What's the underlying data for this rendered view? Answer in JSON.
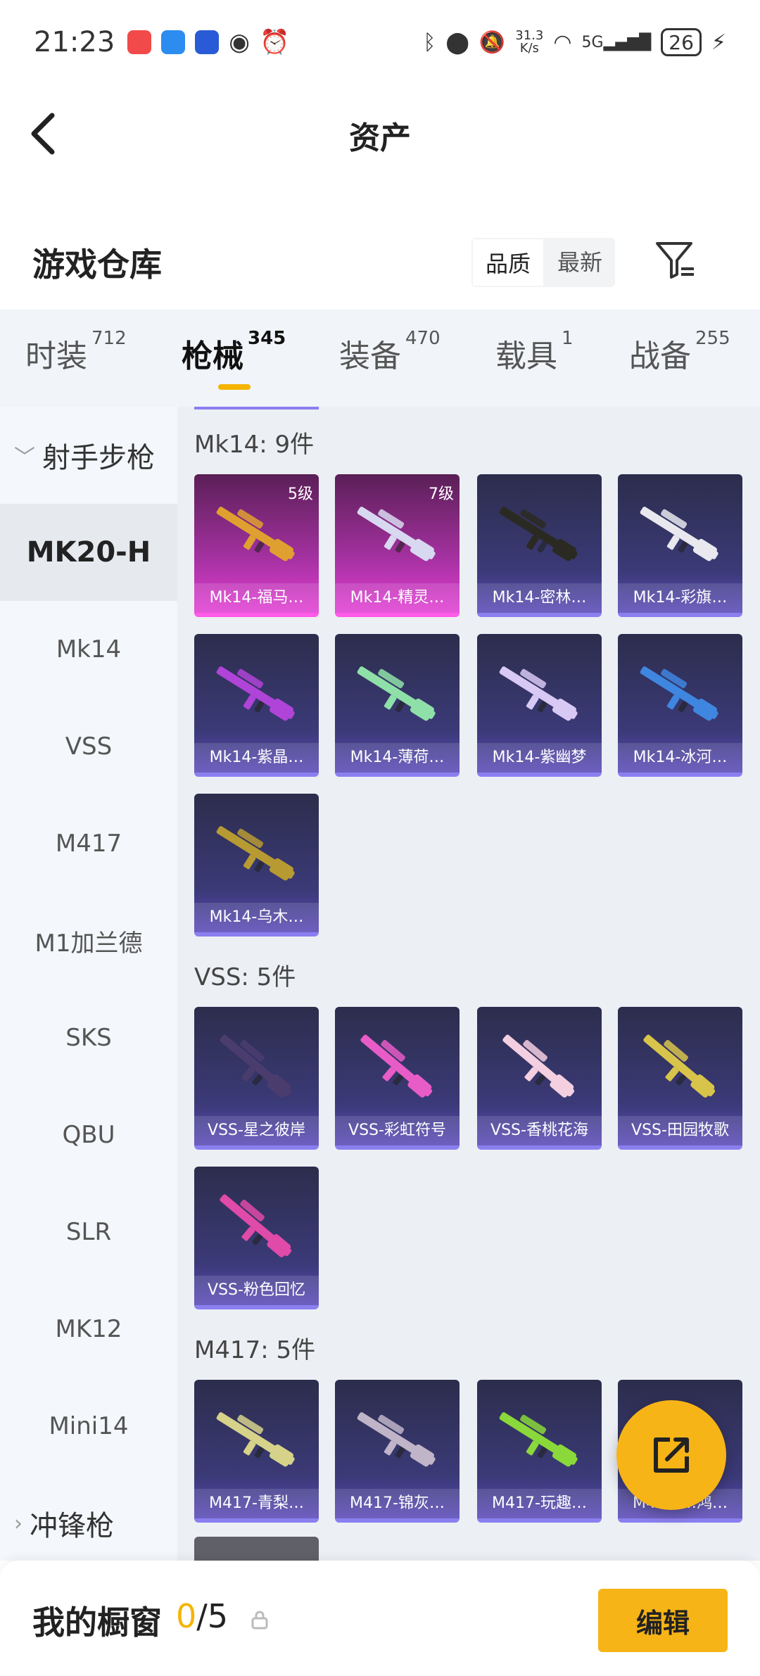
{
  "status_bar": {
    "time": "21:23",
    "speed_top": "31.3",
    "speed_bottom": "K/s",
    "battery": "26",
    "network": "5G"
  },
  "header": {
    "title": "资产"
  },
  "warehouse": {
    "title": "游戏仓库",
    "sort_quality": "品质",
    "sort_latest": "最新"
  },
  "tabs": [
    {
      "label": "时装",
      "count": "712"
    },
    {
      "label": "枪械",
      "count": "345"
    },
    {
      "label": "装备",
      "count": "470"
    },
    {
      "label": "载具",
      "count": "1"
    },
    {
      "label": "战备",
      "count": "255"
    }
  ],
  "sidebar": {
    "group1": "射手步枪",
    "items": [
      "MK20-H",
      "Mk14",
      "VSS",
      "M417",
      "M1加兰德",
      "SKS",
      "QBU",
      "SLR",
      "MK12",
      "Mini14"
    ],
    "group2": "冲锋枪"
  },
  "sections": [
    {
      "title": "Mk14: 9件",
      "cards": [
        {
          "name": "Mk14-福马…",
          "level": "5级",
          "style": "pink",
          "color": "#e0a030"
        },
        {
          "name": "Mk14-精灵…",
          "level": "7级",
          "style": "pink",
          "color": "#d8d8f0"
        },
        {
          "name": "Mk14-密林…",
          "level": "",
          "style": "normal",
          "color": "#2b2a22"
        },
        {
          "name": "Mk14-彩旗…",
          "level": "",
          "style": "normal",
          "color": "#e8e8ee"
        },
        {
          "name": "Mk14-紫晶…",
          "level": "",
          "style": "normal",
          "color": "#b044d8"
        },
        {
          "name": "Mk14-薄荷…",
          "level": "",
          "style": "normal",
          "color": "#8fe0a8"
        },
        {
          "name": "Mk14-紫幽梦",
          "level": "",
          "style": "normal",
          "color": "#d8c8f4"
        },
        {
          "name": "Mk14-冰河…",
          "level": "",
          "style": "normal",
          "color": "#3f86e0"
        },
        {
          "name": "Mk14-乌木…",
          "level": "",
          "style": "normal",
          "color": "#b89a32"
        }
      ]
    },
    {
      "title": "VSS: 5件",
      "cards": [
        {
          "name": "VSS-星之彼岸",
          "level": "",
          "style": "normal",
          "color": "#4a3d6e"
        },
        {
          "name": "VSS-彩虹符号",
          "level": "",
          "style": "normal",
          "color": "#e85cc8"
        },
        {
          "name": "VSS-香桃花海",
          "level": "",
          "style": "normal",
          "color": "#f4cfe0"
        },
        {
          "name": "VSS-田园牧歌",
          "level": "",
          "style": "normal",
          "color": "#d8c44a"
        },
        {
          "name": "VSS-粉色回忆",
          "level": "",
          "style": "normal",
          "color": "#e04aa8"
        }
      ]
    },
    {
      "title": "M417: 5件",
      "cards": [
        {
          "name": "M417-青梨…",
          "level": "",
          "style": "normal",
          "color": "#d6d28a"
        },
        {
          "name": "M417-锦灰…",
          "level": "",
          "style": "normal",
          "color": "#c0b4c8"
        },
        {
          "name": "M417-玩趣…",
          "level": "",
          "style": "normal",
          "color": "#8ad83a"
        },
        {
          "name": "M417-…鸿…",
          "level": "",
          "style": "normal",
          "color": "#e05a5a"
        }
      ]
    }
  ],
  "bottom_bar": {
    "label": "我的橱窗",
    "count_current": "0",
    "count_total": "/5",
    "edit_label": "编辑"
  },
  "colors": {
    "accent": "#f7b416",
    "pink_card": "#e23fd4",
    "normal_card": "#3b3a78"
  }
}
